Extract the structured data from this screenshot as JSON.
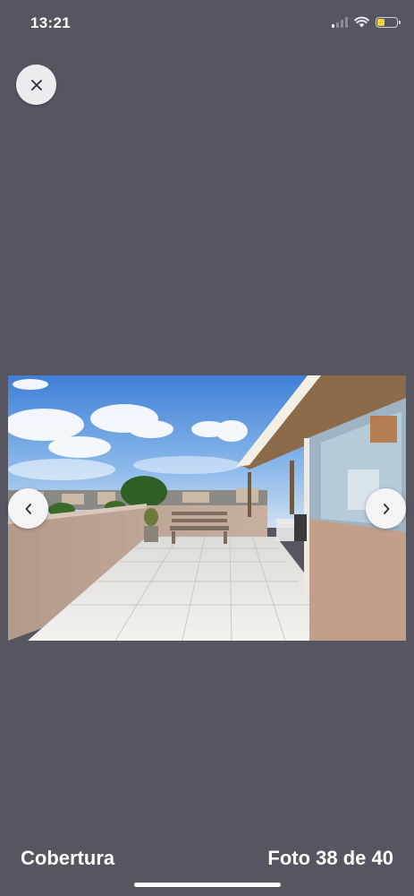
{
  "status_bar": {
    "time": "13:21",
    "signal_bars_active": 1,
    "battery_level": 0.35
  },
  "close_button": {
    "icon": "close-icon"
  },
  "photo": {
    "subject": "Rooftop terrace with tiled floor, wooden bench and covered pergola area"
  },
  "navigation": {
    "prev_icon": "chevron-left-icon",
    "next_icon": "chevron-right-icon"
  },
  "footer": {
    "title": "Cobertura",
    "counter": "Foto 38 de 40"
  },
  "colors": {
    "background": "#565560",
    "button": "#f4f4f6",
    "battery": "#f2d33c"
  }
}
